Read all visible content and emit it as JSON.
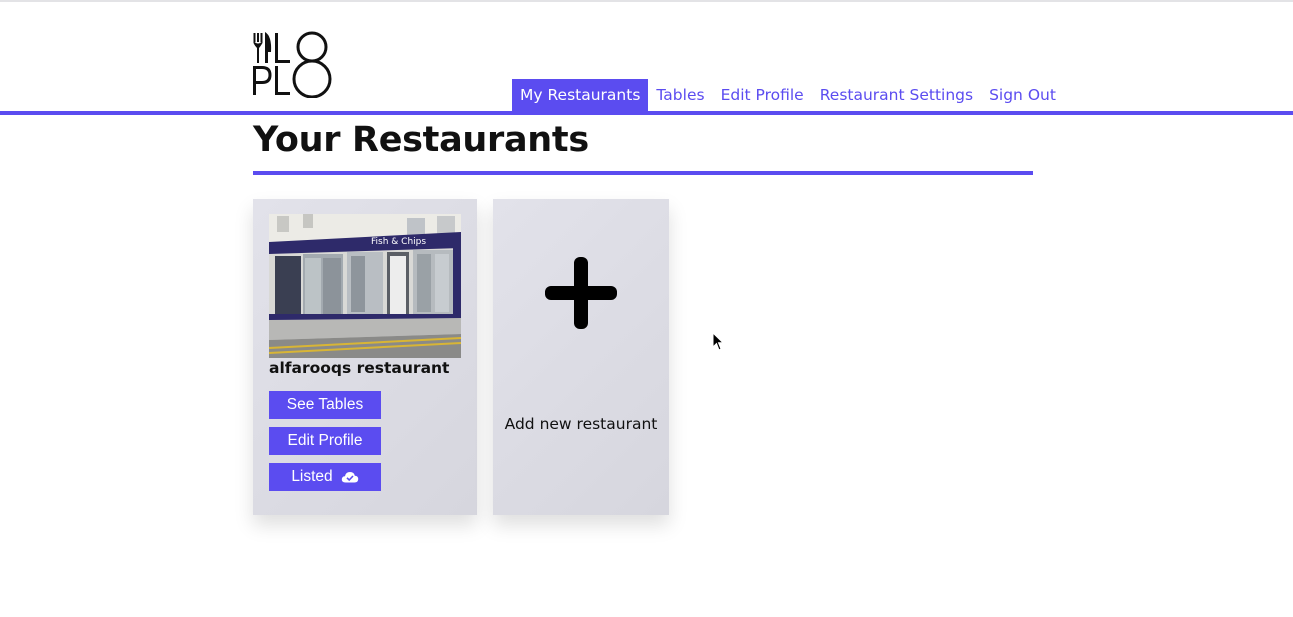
{
  "logo": {
    "lines": [
      "LO",
      "PLO"
    ],
    "icon": "fork-knife-logo"
  },
  "nav": {
    "items": [
      {
        "label": "My Restaurants",
        "active": true
      },
      {
        "label": "Tables",
        "active": false
      },
      {
        "label": "Edit Profile",
        "active": false
      },
      {
        "label": "Restaurant Settings",
        "active": false
      },
      {
        "label": "Sign Out",
        "active": false
      }
    ]
  },
  "page": {
    "title": "Your Restaurants"
  },
  "restaurants": [
    {
      "name": "alfarooqs restaurant",
      "photo_sign": "Fish & Chips",
      "buttons": {
        "see_tables": "See Tables",
        "edit_profile": "Edit Profile",
        "listed": "Listed"
      },
      "listed_icon": "cloud-check-icon"
    }
  ],
  "add_card": {
    "label": "Add new restaurant",
    "icon": "plus-icon"
  },
  "colors": {
    "accent": "#5b4cf0",
    "card_bg": "#dcdce4",
    "text": "#111111"
  }
}
